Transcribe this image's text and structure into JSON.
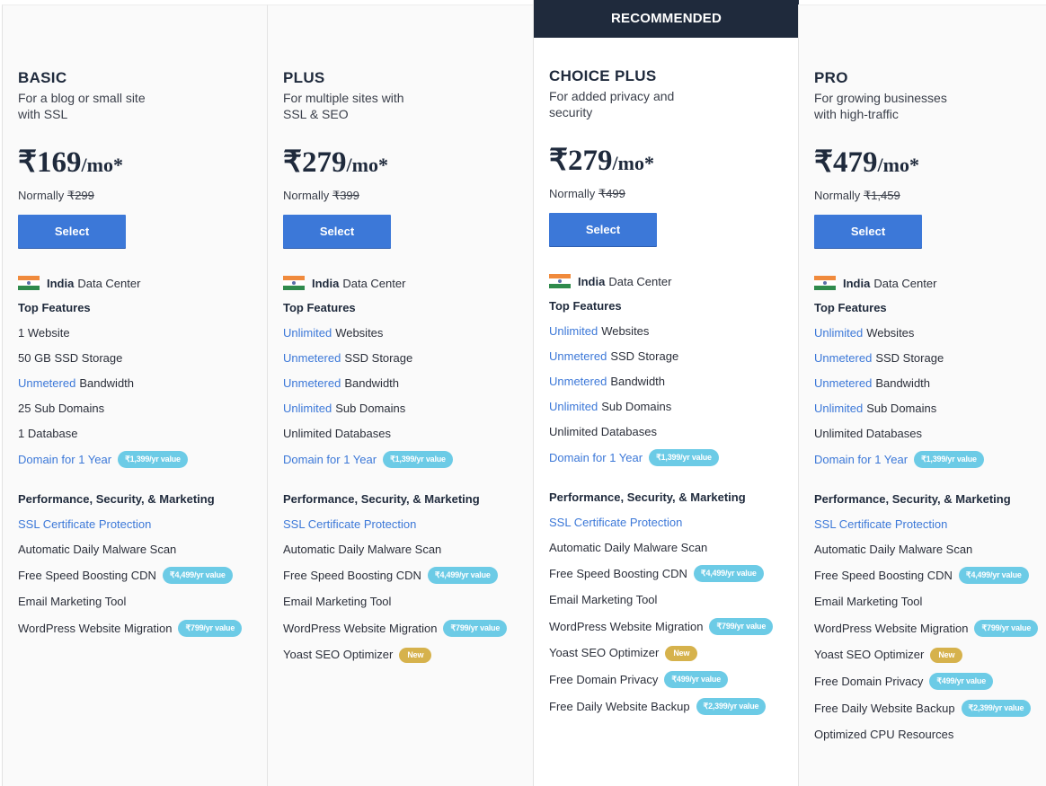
{
  "ribbon_label": "RECOMMENDED",
  "colors": {
    "primary_blue": "#3c78d8",
    "badge_cyan": "#6ccbe6",
    "badge_gold": "#d6b24c",
    "ribbon_navy": "#1f2a3c"
  },
  "common": {
    "select_label": "Select",
    "normally_label": "Normally",
    "price_suffix": "/mo*",
    "dc_bold": "India",
    "dc_rest": "Data Center",
    "top_features_title": "Top Features",
    "perf_title": "Performance, Security, & Marketing"
  },
  "plans": [
    {
      "name": "BASIC",
      "desc": "For a blog or small site with SSL",
      "price": "₹169",
      "normal_price": "₹299",
      "top_features": [
        {
          "hl": "",
          "text": "1 Website"
        },
        {
          "hl": "",
          "text": "50 GB SSD Storage"
        },
        {
          "hl": "Unmetered",
          "text": "Bandwidth"
        },
        {
          "hl": "",
          "text": "25 Sub Domains"
        },
        {
          "hl": "",
          "text": "1 Database"
        },
        {
          "link": "Domain for 1 Year",
          "badge": "₹1,399/yr value"
        }
      ],
      "perf_features": [
        {
          "link": "SSL Certificate Protection"
        },
        {
          "text": "Automatic Daily Malware Scan"
        },
        {
          "text": "Free Speed Boosting CDN",
          "badge": "₹4,499/yr value"
        },
        {
          "text": "Email Marketing Tool"
        },
        {
          "text": "WordPress Website Migration",
          "badge": "₹799/yr value"
        }
      ]
    },
    {
      "name": "PLUS",
      "desc": "For multiple sites with SSL & SEO",
      "price": "₹279",
      "normal_price": "₹399",
      "top_features": [
        {
          "hl": "Unlimited",
          "text": "Websites"
        },
        {
          "hl": "Unmetered",
          "text": "SSD Storage"
        },
        {
          "hl": "Unmetered",
          "text": "Bandwidth"
        },
        {
          "hl": "Unlimited",
          "text": "Sub Domains"
        },
        {
          "hl": "",
          "text": "Unlimited Databases"
        },
        {
          "link": "Domain for 1 Year",
          "badge": "₹1,399/yr value"
        }
      ],
      "perf_features": [
        {
          "link": "SSL Certificate Protection"
        },
        {
          "text": "Automatic Daily Malware Scan"
        },
        {
          "text": "Free Speed Boosting CDN",
          "badge": "₹4,499/yr value"
        },
        {
          "text": "Email Marketing Tool"
        },
        {
          "text": "WordPress Website Migration",
          "badge": "₹799/yr value"
        },
        {
          "text": "Yoast SEO Optimizer",
          "new": "New"
        }
      ]
    },
    {
      "name": "CHOICE PLUS",
      "desc": "For added privacy and security",
      "price": "₹279",
      "normal_price": "₹499",
      "recommended": true,
      "top_features": [
        {
          "hl": "Unlimited",
          "text": "Websites"
        },
        {
          "hl": "Unmetered",
          "text": "SSD Storage"
        },
        {
          "hl": "Unmetered",
          "text": "Bandwidth"
        },
        {
          "hl": "Unlimited",
          "text": "Sub Domains"
        },
        {
          "hl": "",
          "text": "Unlimited Databases"
        },
        {
          "link": "Domain for 1 Year",
          "badge": "₹1,399/yr value"
        }
      ],
      "perf_features": [
        {
          "link": "SSL Certificate Protection"
        },
        {
          "text": "Automatic Daily Malware Scan"
        },
        {
          "text": "Free Speed Boosting CDN",
          "badge": "₹4,499/yr value"
        },
        {
          "text": "Email Marketing Tool"
        },
        {
          "text": "WordPress Website Migration",
          "badge": "₹799/yr value"
        },
        {
          "text": "Yoast SEO Optimizer",
          "new": "New"
        },
        {
          "text": "Free Domain Privacy",
          "badge": "₹499/yr value"
        },
        {
          "text": "Free Daily Website Backup",
          "badge": "₹2,399/yr value"
        }
      ]
    },
    {
      "name": "PRO",
      "desc": "For growing businesses with high-traffic",
      "price": "₹479",
      "normal_price": "₹1,459",
      "top_features": [
        {
          "hl": "Unlimited",
          "text": "Websites"
        },
        {
          "hl": "Unmetered",
          "text": "SSD Storage"
        },
        {
          "hl": "Unmetered",
          "text": "Bandwidth"
        },
        {
          "hl": "Unlimited",
          "text": "Sub Domains"
        },
        {
          "hl": "",
          "text": "Unlimited Databases"
        },
        {
          "link": "Domain for 1 Year",
          "badge": "₹1,399/yr value"
        }
      ],
      "perf_features": [
        {
          "link": "SSL Certificate Protection"
        },
        {
          "text": "Automatic Daily Malware Scan"
        },
        {
          "text": "Free Speed Boosting CDN",
          "badge": "₹4,499/yr value"
        },
        {
          "text": "Email Marketing Tool"
        },
        {
          "text": "WordPress Website Migration",
          "badge": "₹799/yr value"
        },
        {
          "text": "Yoast SEO Optimizer",
          "new": "New"
        },
        {
          "text": "Free Domain Privacy",
          "badge": "₹499/yr value"
        },
        {
          "text": "Free Daily Website Backup",
          "badge": "₹2,399/yr value"
        },
        {
          "text": "Optimized CPU Resources"
        }
      ]
    }
  ]
}
